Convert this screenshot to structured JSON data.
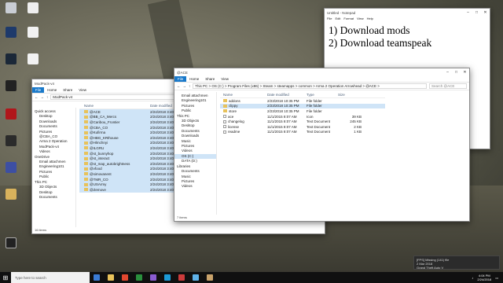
{
  "desktop": {
    "icons": [
      "",
      "",
      "",
      "",
      "",
      "",
      "",
      "",
      "",
      "",
      "",
      ""
    ]
  },
  "notepad": {
    "title": "Untitled - Notepad",
    "menu": [
      "File",
      "Edit",
      "Format",
      "View",
      "Help"
    ],
    "lines": [
      "1) Download mods",
      "2) Download teamspeak"
    ]
  },
  "explorer_left": {
    "title": "ModPack-v4",
    "ribbon": [
      "File",
      "Home",
      "Share",
      "View"
    ],
    "path": "ModPack-v4",
    "nav": [
      "Quick access",
      "Desktop",
      "Downloads",
      "Documents",
      "Pictures",
      "@CBA_CO",
      "Arma 2 Operation",
      "ModPack-v4",
      "Videos",
      "OneDrive",
      "Email attachmen",
      "Engineering101",
      "Pictures",
      "Public",
      "This PC",
      "3D Objects",
      "Desktop",
      "Documents"
    ],
    "columns": [
      "Name",
      "Date modified"
    ],
    "rows": [
      [
        "@ACE",
        "2/24/2018 3:40 PM"
      ],
      [
        "@BB_CA_Mercs",
        "2/24/2018 3:40 PM"
      ],
      [
        "@Caribou_Frontier",
        "2/24/2018 3:40 PM"
      ],
      [
        "@CBA_CO",
        "2/24/2018 3:40 PM"
      ],
      [
        "@Kufirma",
        "2/24/2018 3:40 PM"
      ],
      [
        "@HBG_KRthouse",
        "2/24/2018 3:40 PM"
      ],
      [
        "@Hlmchnyi",
        "2/24/2018 3:40 PM"
      ],
      [
        "@ILGRU",
        "2/24/2018 3:40 PM"
      ],
      [
        "@st_bunnyhop",
        "2/24/2018 3:40 PM"
      ],
      [
        "@st_interact",
        "2/24/2018 3:40 PM"
      ],
      [
        "@st_map_autobrightness",
        "2/24/2018 3:40 PM"
      ],
      [
        "@vfood",
        "2/24/2018 3:40 PM"
      ],
      [
        "@simovanent",
        "2/24/2018 3:40 PM"
      ],
      [
        "@TMR_CO",
        "2/24/2018 3:40 PM"
      ],
      [
        "@USArmy",
        "2/24/2018 3:40 PM"
      ],
      [
        "@Zemove",
        "2/24/2018 3:40 PM"
      ]
    ],
    "status": "16 items"
  },
  "explorer_main": {
    "title": "@ACE",
    "ribbon": [
      "File",
      "Home",
      "Share",
      "View"
    ],
    "path": "This PC  >  OS (C:)  >  Program Files (x86)  >  Steam  >  steamapps  >  common  >  Arma 2 Operation Arrowhead  >  @ACE  >",
    "search_placeholder": "Search @ACE",
    "nav": [
      "Email attachmen",
      "Engineering101",
      "Pictures",
      "Public",
      "This PC",
      "3D Objects",
      "Desktop",
      "Documents",
      "Downloads",
      "Music",
      "Pictures",
      "Videos",
      "OS (C:)",
      "DATA (D:)",
      "Libraries",
      "Documents",
      "Music",
      "Pictures",
      "Videos"
    ],
    "columns": [
      "Name",
      "Date modified",
      "Type",
      "Size"
    ],
    "rows": [
      {
        "name": "addons",
        "date": "2/23/2018 10:35 PM",
        "type": "File folder",
        "size": "",
        "kind": "folder"
      },
      {
        "name": "clippy",
        "date": "2/23/2018 10:35 PM",
        "type": "File folder",
        "size": "",
        "kind": "folder"
      },
      {
        "name": "store",
        "date": "2/23/2018 10:35 PM",
        "type": "File folder",
        "size": "",
        "kind": "folder"
      },
      {
        "name": "ace",
        "date": "11/1/2015 8:07 AM",
        "type": "Icon",
        "size": "39 KB",
        "kind": "doc"
      },
      {
        "name": "changelog",
        "date": "11/1/2015 8:07 AM",
        "type": "Text Document",
        "size": "245 KB",
        "kind": "doc"
      },
      {
        "name": "license",
        "date": "11/1/2015 8:07 AM",
        "type": "Text Document",
        "size": "2 KB",
        "kind": "doc"
      },
      {
        "name": "readme",
        "date": "11/1/2015 8:07 AM",
        "type": "Text Document",
        "size": "1 KB",
        "kind": "doc"
      }
    ],
    "status": "7 items"
  },
  "taskbar": {
    "search_placeholder": "Type here to search",
    "time": "4:04 PM",
    "date": "2/24/2018",
    "apps": [
      "#3a7bd5",
      "#e8c25a",
      "#e2472f",
      "#2a8f3d",
      "#8a5cd1",
      "#1c9ad6",
      "#cc3b3b",
      "#5fb2e8",
      "#c9a36b"
    ]
  },
  "toast": {
    "line1": "[FPS] Missing (141) file",
    "line2": "2 Mar 2018",
    "line3": "Grand Theft Auto V"
  }
}
